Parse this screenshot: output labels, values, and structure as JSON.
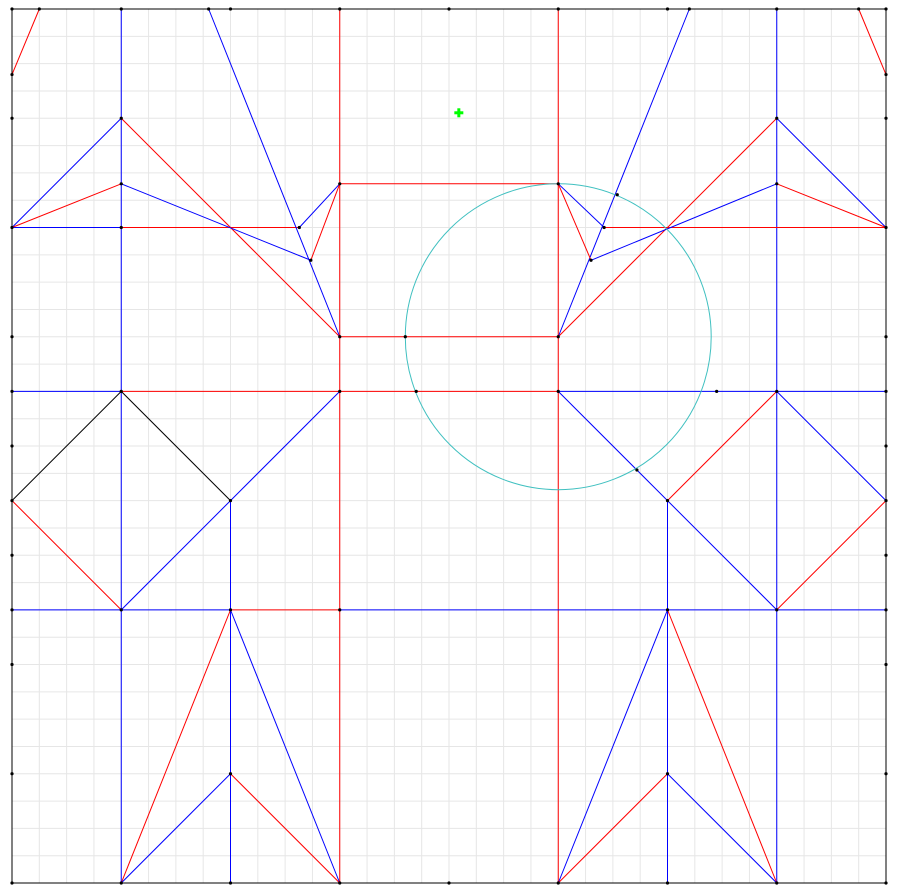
{
  "colors": {
    "background": "#ffffff",
    "grid": "#e6e6e6",
    "border": "#000000",
    "mountain": "#ff0000",
    "valley": "#0000ff",
    "aux": "#000000",
    "circle": "#40c0c0",
    "vertex": "#000000",
    "cursor": "#00ff00"
  },
  "icons": {
    "cursor": "green-plus-cursor-icon"
  },
  "crease_pattern": {
    "grid_divisions": 16,
    "lines": [
      {
        "type": "valley",
        "from": [
          2,
          0
        ],
        "to": [
          2,
          16
        ]
      },
      {
        "type": "mountain",
        "from": [
          6,
          0
        ],
        "to": [
          6,
          16
        ]
      },
      {
        "type": "mountain",
        "from": [
          10,
          0
        ],
        "to": [
          10,
          16
        ]
      },
      {
        "type": "valley",
        "from": [
          14,
          0
        ],
        "to": [
          14,
          16
        ]
      },
      {
        "type": "valley",
        "from": [
          0,
          7
        ],
        "to": [
          2,
          7
        ]
      },
      {
        "type": "mountain",
        "from": [
          2,
          7
        ],
        "to": [
          10,
          7
        ]
      },
      {
        "type": "valley",
        "from": [
          10,
          7
        ],
        "to": [
          16,
          7
        ]
      },
      {
        "type": "valley",
        "from": [
          0,
          11
        ],
        "to": [
          4,
          11
        ]
      },
      {
        "type": "mountain",
        "from": [
          4,
          11
        ],
        "to": [
          6,
          11
        ]
      },
      {
        "type": "valley",
        "from": [
          6,
          11
        ],
        "to": [
          16,
          11
        ]
      },
      {
        "type": "valley",
        "from": [
          0,
          4
        ],
        "to": [
          2,
          4
        ]
      },
      {
        "type": "mountain",
        "from": [
          2,
          4
        ],
        "to": [
          5.26,
          4
        ]
      },
      {
        "type": "mountain",
        "from": [
          10.84,
          4
        ],
        "to": [
          16,
          4
        ]
      },
      {
        "type": "mountain",
        "from": [
          6,
          3.2
        ],
        "to": [
          10,
          3.2
        ]
      },
      {
        "type": "mountain",
        "from": [
          6,
          6
        ],
        "to": [
          10,
          6
        ]
      },
      {
        "type": "mountain",
        "from": [
          0,
          1.2
        ],
        "to": [
          0.5,
          0
        ]
      },
      {
        "type": "mountain",
        "from": [
          15.5,
          0
        ],
        "to": [
          16,
          1.2
        ]
      },
      {
        "type": "valley",
        "from": [
          3.6,
          0
        ],
        "to": [
          6,
          6
        ]
      },
      {
        "type": "valley",
        "from": [
          12.4,
          0
        ],
        "to": [
          10,
          6
        ]
      },
      {
        "type": "valley",
        "from": [
          0,
          4
        ],
        "to": [
          2,
          2
        ]
      },
      {
        "type": "mountain",
        "from": [
          2,
          2
        ],
        "to": [
          6,
          6
        ]
      },
      {
        "type": "valley",
        "from": [
          16,
          4
        ],
        "to": [
          14,
          2
        ]
      },
      {
        "type": "mountain",
        "from": [
          14,
          2
        ],
        "to": [
          10,
          6
        ]
      },
      {
        "type": "mountain",
        "from": [
          0,
          4
        ],
        "to": [
          2,
          3.2
        ]
      },
      {
        "type": "valley",
        "from": [
          2,
          3.2
        ],
        "to": [
          5.47,
          4.6
        ]
      },
      {
        "type": "mountain",
        "from": [
          16,
          4
        ],
        "to": [
          14,
          3.2
        ]
      },
      {
        "type": "valley",
        "from": [
          14,
          3.2
        ],
        "to": [
          10.6,
          4.6
        ]
      },
      {
        "type": "valley",
        "from": [
          5.26,
          4
        ],
        "to": [
          6,
          3.2
        ]
      },
      {
        "type": "mountain",
        "from": [
          5.47,
          4.6
        ],
        "to": [
          6,
          3.2
        ]
      },
      {
        "type": "valley",
        "from": [
          10.84,
          4
        ],
        "to": [
          10,
          3.2
        ]
      },
      {
        "type": "mountain",
        "from": [
          10.6,
          4.6
        ],
        "to": [
          10,
          3.2
        ]
      },
      {
        "type": "aux",
        "from": [
          0,
          9
        ],
        "to": [
          2,
          7
        ]
      },
      {
        "type": "mountain",
        "from": [
          0,
          9
        ],
        "to": [
          2,
          11
        ]
      },
      {
        "type": "aux",
        "from": [
          2,
          7
        ],
        "to": [
          4,
          9
        ]
      },
      {
        "type": "valley",
        "from": [
          2,
          11
        ],
        "to": [
          6,
          7
        ]
      },
      {
        "type": "valley",
        "from": [
          4,
          9
        ],
        "to": [
          4,
          11
        ]
      },
      {
        "type": "valley",
        "from": [
          10,
          7
        ],
        "to": [
          14,
          11
        ]
      },
      {
        "type": "mountain",
        "from": [
          12,
          9
        ],
        "to": [
          14,
          7
        ]
      },
      {
        "type": "valley",
        "from": [
          14,
          7
        ],
        "to": [
          16,
          9
        ]
      },
      {
        "type": "mountain",
        "from": [
          16,
          9
        ],
        "to": [
          14,
          11
        ]
      },
      {
        "type": "valley",
        "from": [
          12,
          9
        ],
        "to": [
          12,
          11
        ]
      },
      {
        "type": "valley",
        "from": [
          4,
          11
        ],
        "to": [
          4,
          16
        ]
      },
      {
        "type": "mountain",
        "from": [
          4,
          11
        ],
        "to": [
          2,
          16
        ]
      },
      {
        "type": "valley",
        "from": [
          4,
          11
        ],
        "to": [
          6,
          16
        ]
      },
      {
        "type": "valley",
        "from": [
          2,
          16
        ],
        "to": [
          4,
          14
        ]
      },
      {
        "type": "mountain",
        "from": [
          4,
          14
        ],
        "to": [
          6,
          16
        ]
      },
      {
        "type": "valley",
        "from": [
          12,
          11
        ],
        "to": [
          12,
          16
        ]
      },
      {
        "type": "valley",
        "from": [
          12,
          11
        ],
        "to": [
          10,
          16
        ]
      },
      {
        "type": "mountain",
        "from": [
          12,
          11
        ],
        "to": [
          14,
          16
        ]
      },
      {
        "type": "mountain",
        "from": [
          10,
          16
        ],
        "to": [
          12,
          14
        ]
      },
      {
        "type": "valley",
        "from": [
          12,
          14
        ],
        "to": [
          14,
          16
        ]
      }
    ],
    "circle": {
      "center": [
        10,
        6
      ],
      "radius": 2.8
    },
    "extra_points": [
      [
        7.2,
        6
      ],
      [
        7.4,
        7
      ],
      [
        12.9,
        7
      ],
      [
        11.44,
        8.44
      ],
      [
        11.08,
        3.4
      ],
      [
        10.6,
        4.6
      ],
      [
        10.84,
        4
      ],
      [
        5.26,
        4
      ],
      [
        5.47,
        4.6
      ],
      [
        6,
        3.2
      ],
      [
        10,
        3.2
      ]
    ],
    "cursor": [
      8.18,
      1.9
    ]
  }
}
